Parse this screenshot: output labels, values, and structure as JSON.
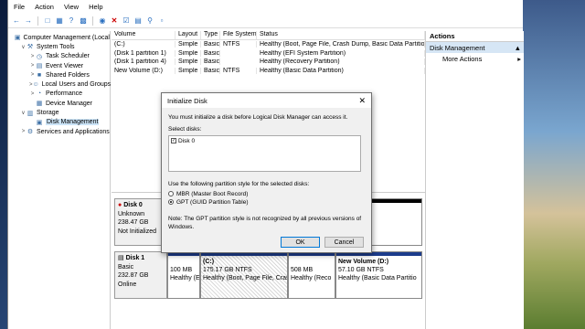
{
  "menu": [
    "File",
    "Action",
    "View",
    "Help"
  ],
  "tree": [
    {
      "label": "Computer Management (Local",
      "indent": 0,
      "icon": "computer-icon",
      "expander": ""
    },
    {
      "label": "System Tools",
      "indent": 1,
      "icon": "tools-icon",
      "expander": "∨"
    },
    {
      "label": "Task Scheduler",
      "indent": 2,
      "icon": "clock-icon",
      "expander": ">"
    },
    {
      "label": "Event Viewer",
      "indent": 2,
      "icon": "event-icon",
      "expander": ">"
    },
    {
      "label": "Shared Folders",
      "indent": 2,
      "icon": "folder-icon",
      "expander": ">"
    },
    {
      "label": "Local Users and Groups",
      "indent": 2,
      "icon": "users-icon",
      "expander": ">"
    },
    {
      "label": "Performance",
      "indent": 2,
      "icon": "performance-icon",
      "expander": ">"
    },
    {
      "label": "Device Manager",
      "indent": 2,
      "icon": "device-icon",
      "expander": ""
    },
    {
      "label": "Storage",
      "indent": 1,
      "icon": "storage-icon",
      "expander": "∨"
    },
    {
      "label": "Disk Management",
      "indent": 2,
      "icon": "disk-icon",
      "expander": "",
      "selected": true
    },
    {
      "label": "Services and Applications",
      "indent": 1,
      "icon": "services-icon",
      "expander": ">"
    }
  ],
  "volumes": {
    "headers": [
      "Volume",
      "Layout",
      "Type",
      "File System",
      "Status"
    ],
    "rows": [
      [
        "(C:)",
        "Simple",
        "Basic",
        "NTFS",
        "Healthy (Boot, Page File, Crash Dump, Basic Data Partition)"
      ],
      [
        "(Disk 1 partition 1)",
        "Simple",
        "Basic",
        "",
        "Healthy (EFI System Partition)"
      ],
      [
        "(Disk 1 partition 4)",
        "Simple",
        "Basic",
        "",
        "Healthy (Recovery Partition)"
      ],
      [
        "New Volume (D:)",
        "Simple",
        "Basic",
        "NTFS",
        "Healthy (Basic Data Partition)"
      ]
    ]
  },
  "actions": {
    "header": "Actions",
    "section": "Disk Management",
    "more": "More Actions"
  },
  "dialog": {
    "title": "Initialize Disk",
    "message": "You must initialize a disk before Logical Disk Manager can access it.",
    "select_label": "Select disks:",
    "disk_item": "Disk 0",
    "style_label": "Use the following partition style for the selected disks:",
    "mbr": "MBR (Master Boot Record)",
    "gpt": "GPT (GUID Partition Table)",
    "note": "Note: The GPT partition style is not recognized by all previous versions of Windows.",
    "ok": "OK",
    "cancel": "Cancel"
  },
  "disk0": {
    "name": "Disk 0",
    "type": "Unknown",
    "size": "238.47 GB",
    "status": "Not Initialized"
  },
  "disk1": {
    "name": "Disk 1",
    "type": "Basic",
    "size": "232.87 GB",
    "status": "Online",
    "partitions": [
      {
        "title": "",
        "size": "100 MB",
        "status": "Healthy (E"
      },
      {
        "title": "(C:)",
        "size": "175.17 GB NTFS",
        "status": "Healthy (Boot, Page File, Crash"
      },
      {
        "title": "",
        "size": "508 MB",
        "status": "Healthy (Reco"
      },
      {
        "title": "New Volume (D:)",
        "size": "57.10 GB NTFS",
        "status": "Healthy (Basic Data Partitio"
      }
    ]
  }
}
